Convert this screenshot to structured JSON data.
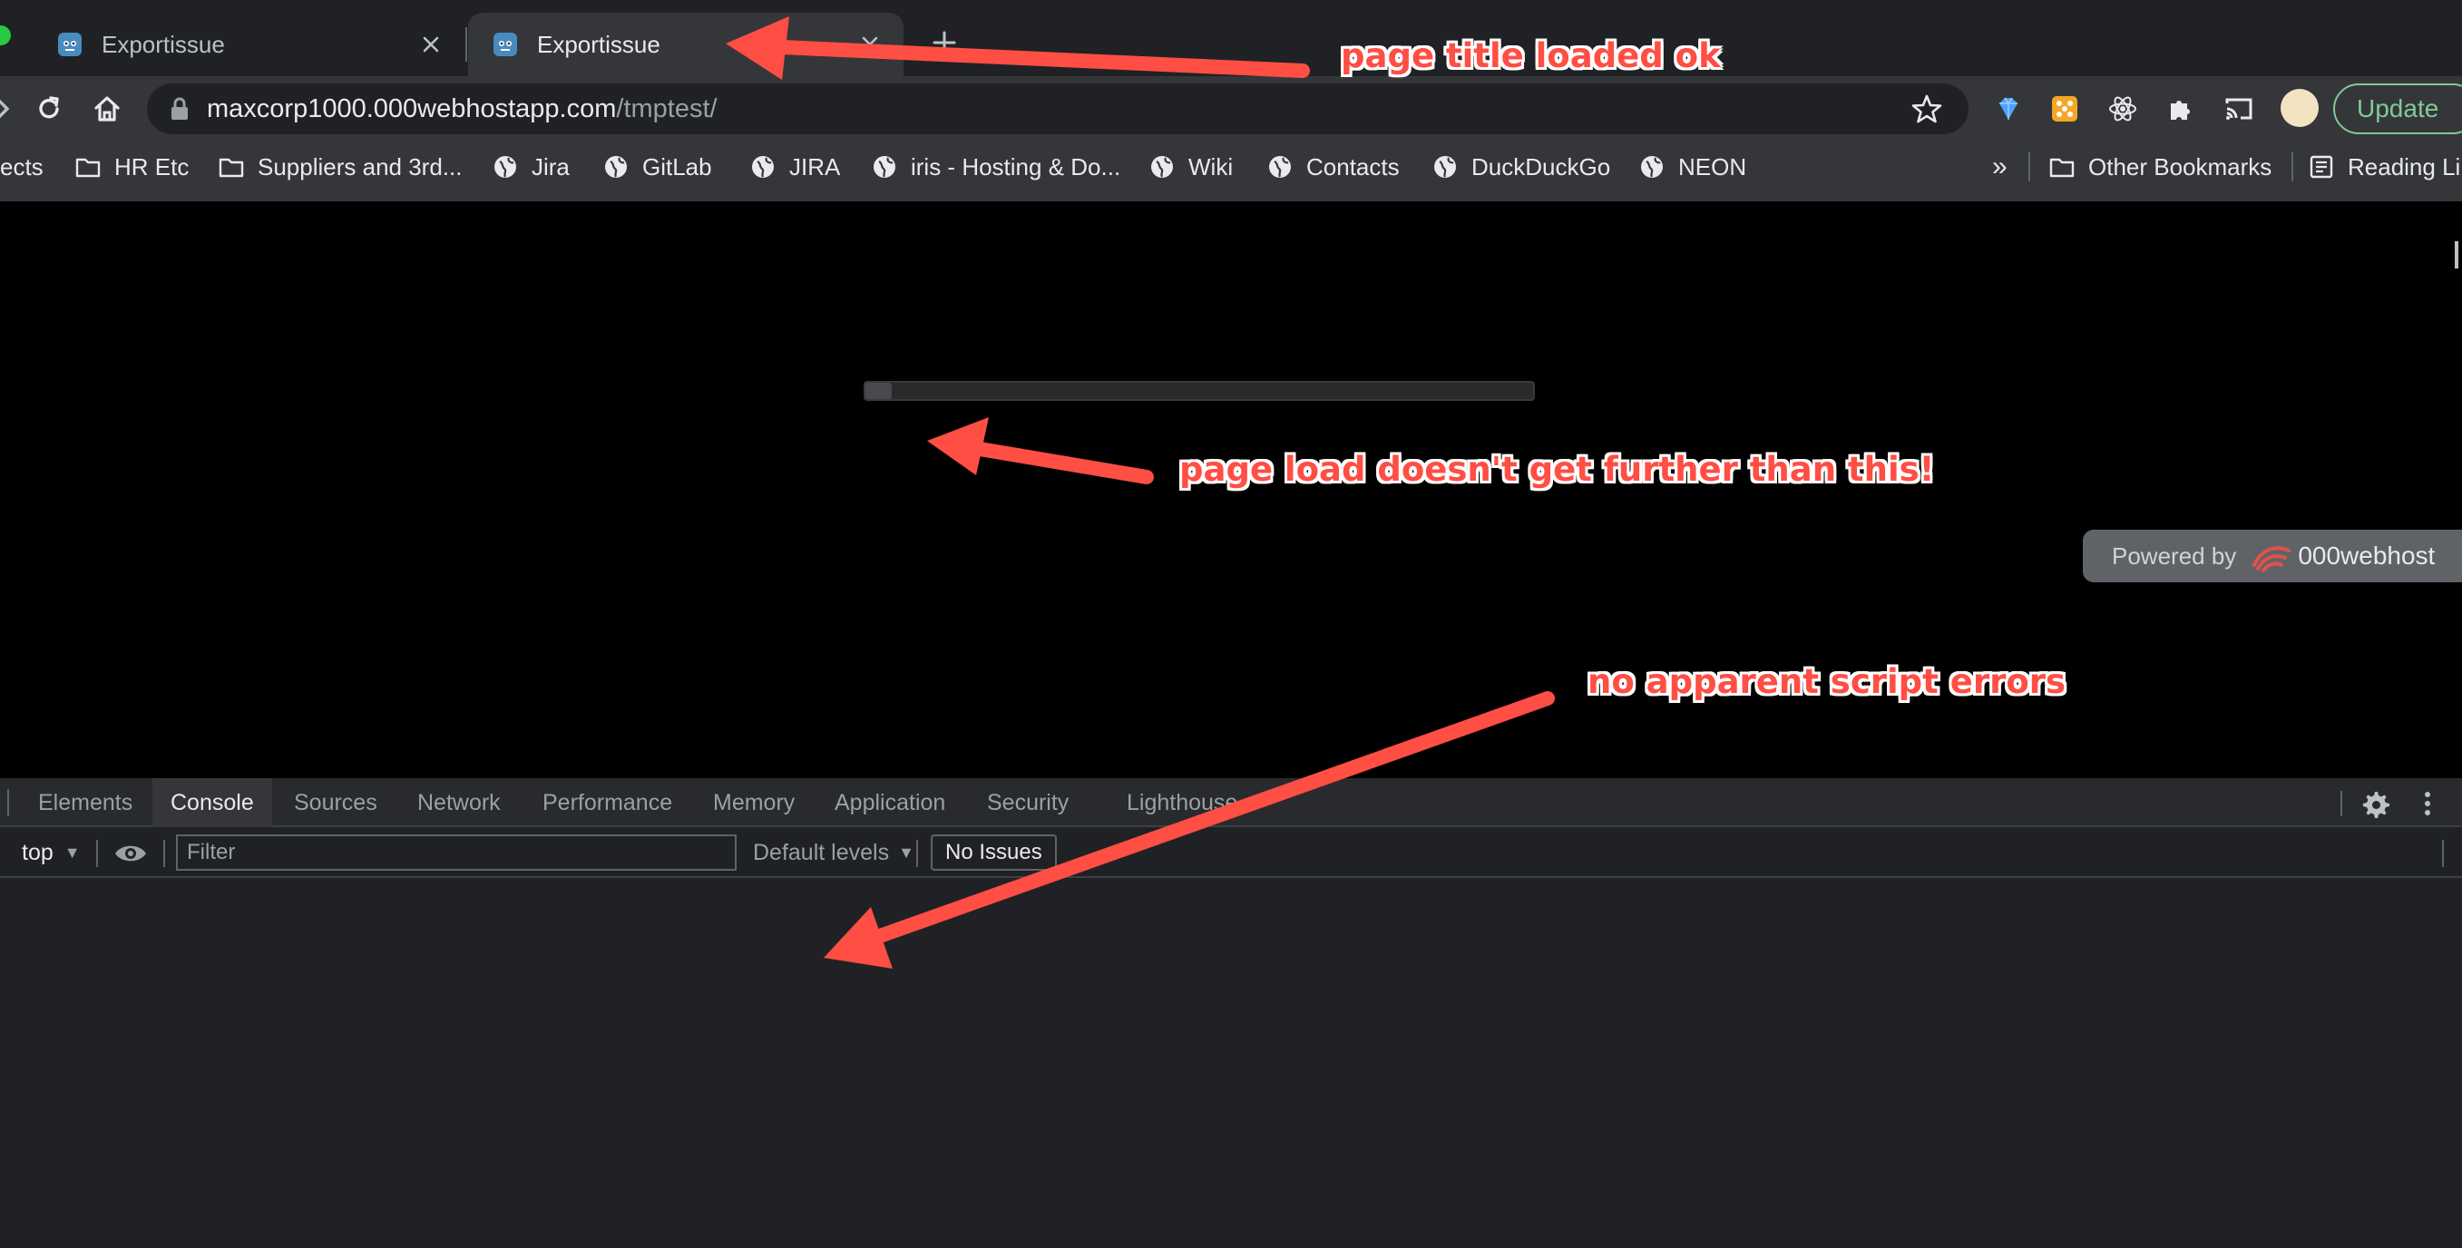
{
  "browser": {
    "tabs": [
      {
        "title": "Exportissue",
        "active": false
      },
      {
        "title": "Exportissue",
        "active": true
      }
    ],
    "address": {
      "host": "maxcorp1000.000webhostapp.com",
      "path": "/tmptest/"
    },
    "update_label": "Update",
    "bookmarks": [
      {
        "label": "ects",
        "icon": "none"
      },
      {
        "label": "HR Etc",
        "icon": "folder-icon"
      },
      {
        "label": "Suppliers and 3rd...",
        "icon": "folder-icon"
      },
      {
        "label": "Jira",
        "icon": "globe-icon"
      },
      {
        "label": "GitLab",
        "icon": "globe-icon"
      },
      {
        "label": "JIRA",
        "icon": "globe-icon"
      },
      {
        "label": "iris - Hosting & Do...",
        "icon": "globe-icon"
      },
      {
        "label": "Wiki",
        "icon": "globe-icon"
      },
      {
        "label": "Contacts",
        "icon": "globe-icon"
      },
      {
        "label": "DuckDuckGo",
        "icon": "globe-icon"
      },
      {
        "label": "NEON",
        "icon": "globe-icon"
      }
    ],
    "bookmarks_overflow": "»",
    "other_bookmarks": "Other Bookmarks",
    "reading_list": "Reading Li"
  },
  "page": {
    "load_progress": 0.04,
    "powered_by": "Powered by",
    "powered_brand": "000webhost"
  },
  "devtools": {
    "tabs": [
      "Elements",
      "Console",
      "Sources",
      "Network",
      "Performance",
      "Memory",
      "Application",
      "Security",
      "Lighthouse"
    ],
    "selected_tab": "Console",
    "context": "top",
    "filter_placeholder": "Filter",
    "levels": "Default levels",
    "issues": "No Issues"
  },
  "annotations": {
    "title_note": "page title loaded ok",
    "load_note": "page load doesn't get further than this!",
    "errors_note": "no apparent script errors"
  },
  "colors": {
    "annotation": "#ff4e44",
    "update_accent": "#81c995"
  }
}
